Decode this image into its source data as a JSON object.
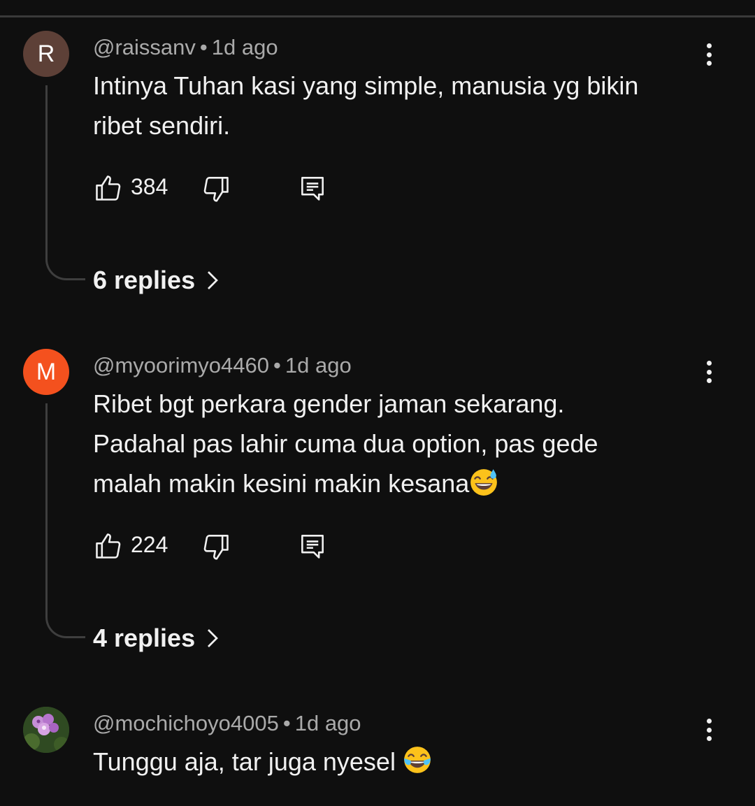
{
  "comments": [
    {
      "avatar_letter": "R",
      "avatar_color": "#5d4037",
      "author": "@raissanv",
      "time": "1d ago",
      "text": "Intinya Tuhan kasi yang simple, manusia yg bikin ribet sendiri.",
      "likes": "384",
      "replies": "6 replies"
    },
    {
      "avatar_letter": "M",
      "avatar_color": "#f4511e",
      "author": "@myoorimyo4460",
      "time": "1d ago",
      "text_lines": [
        "Ribet bgt perkara gender jaman sekarang.",
        "Padahal pas lahir cuma dua option, pas gede",
        "malah makin kesini makin kesana"
      ],
      "emoji": "grinning-sweat",
      "likes": "224",
      "replies": "4 replies"
    },
    {
      "avatar_icon": "orchid-photo",
      "author": "@mochichoyo4005",
      "time": "1d ago",
      "text": "Tunggu aja, tar juga nyesel",
      "emoji": "tears-of-joy"
    }
  ],
  "colors": {
    "background": "#0f0f0f",
    "text_primary": "#f1f1f1",
    "text_secondary": "#aaaaaa",
    "thread_line": "#3e3e3e"
  }
}
